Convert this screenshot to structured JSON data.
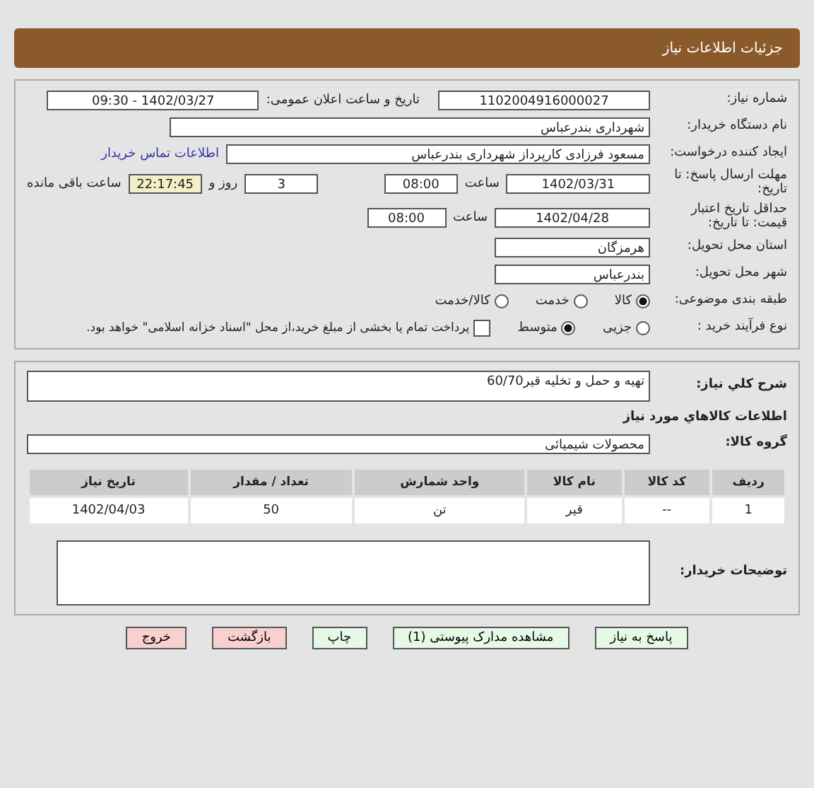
{
  "header": {
    "title": "جزئیات اطلاعات نیاز"
  },
  "need_number": {
    "label": "شماره نیاز:",
    "value": "1102004916000027"
  },
  "announce": {
    "label": "تاریخ و ساعت اعلان عمومی:",
    "value": "1402/03/27 - 09:30"
  },
  "buyer_org": {
    "label": "نام دستگاه خریدار:",
    "value": "شهرداری بندرعباس"
  },
  "requester": {
    "label": "ایجاد کننده درخواست:",
    "value": "مسعود فرزادی کارپرداز شهرداری بندرعباس",
    "link": "اطلاعات تماس خریدار"
  },
  "deadline": {
    "label": "مهلت ارسال پاسخ: تا تاریخ:",
    "date": "1402/03/31",
    "time_label": "ساعت",
    "time": "08:00",
    "days": "3",
    "days_label": "روز و",
    "remaining": "22:17:45",
    "remaining_label": "ساعت باقی مانده"
  },
  "validity": {
    "label": "حداقل تاریخ اعتبار قیمت: تا تاریخ:",
    "date": "1402/04/28",
    "time_label": "ساعت",
    "time": "08:00"
  },
  "province": {
    "label": "استان محل تحویل:",
    "value": "هرمزگان"
  },
  "city": {
    "label": "شهر محل تحویل:",
    "value": "بندرعباس"
  },
  "category": {
    "label": "طبقه بندی موضوعی:",
    "options": [
      {
        "label": "کالا",
        "selected": true
      },
      {
        "label": "خدمت",
        "selected": false
      },
      {
        "label": "کالا/خدمت",
        "selected": false
      }
    ]
  },
  "process": {
    "label": "نوع فرآیند خرید :",
    "options": [
      {
        "label": "جزیی",
        "selected": false
      },
      {
        "label": "متوسط",
        "selected": true
      }
    ],
    "payment": {
      "label": "پرداخت تمام یا بخشی از مبلغ خرید،از محل \"اسناد خزانه اسلامی\" خواهد بود.",
      "checked": false
    }
  },
  "description": {
    "label": "شرح کلي نياز:",
    "value": "تهیه و حمل و تخلیه قیر60/70"
  },
  "goods_title": "اطلاعات کالاهاي مورد نياز",
  "goods_group": {
    "label": "گروه کالا:",
    "value": "محصولات شیمیائی"
  },
  "table": {
    "columns": [
      "ردیف",
      "کد کالا",
      "نام کالا",
      "واحد شمارش",
      "تعداد / مقدار",
      "تاریخ نیاز"
    ],
    "rows": [
      [
        "1",
        "--",
        "قیر",
        "تن",
        "50",
        "1402/04/03"
      ]
    ]
  },
  "buyer_notes": {
    "label": "توضیحات خریدار:"
  },
  "buttons": [
    {
      "label": "پاسخ به نیاز",
      "kind": "green"
    },
    {
      "label": "مشاهده مدارک پیوستی (1)",
      "kind": "green"
    },
    {
      "label": "چاپ",
      "kind": "green"
    },
    {
      "label": "بازگشت",
      "kind": "red"
    },
    {
      "label": "خروج",
      "kind": "red"
    }
  ]
}
